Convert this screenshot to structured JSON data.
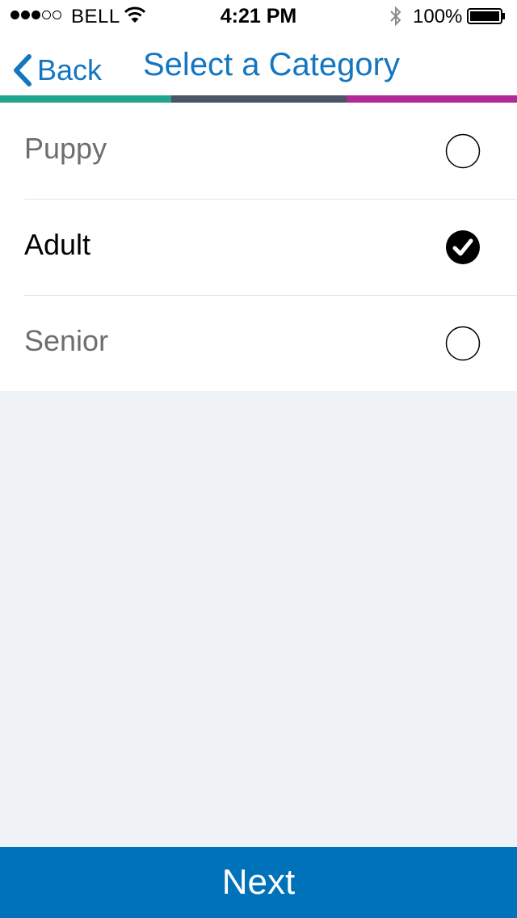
{
  "status_bar": {
    "carrier": "BELL",
    "time": "4:21 PM",
    "battery": "100%",
    "signal_bars_filled": 3,
    "signal_bars_total": 5
  },
  "nav": {
    "back_label": "Back",
    "title": "Select a Category"
  },
  "progress_colors": [
    "#22a58d",
    "#4b5563",
    "#b02a96"
  ],
  "options": [
    {
      "label": "Puppy",
      "selected": false
    },
    {
      "label": "Adult",
      "selected": true
    },
    {
      "label": "Senior",
      "selected": false
    }
  ],
  "footer": {
    "next_label": "Next"
  },
  "colors": {
    "accent": "#1476c0",
    "button": "#0072b9",
    "background": "#eff3f6"
  }
}
